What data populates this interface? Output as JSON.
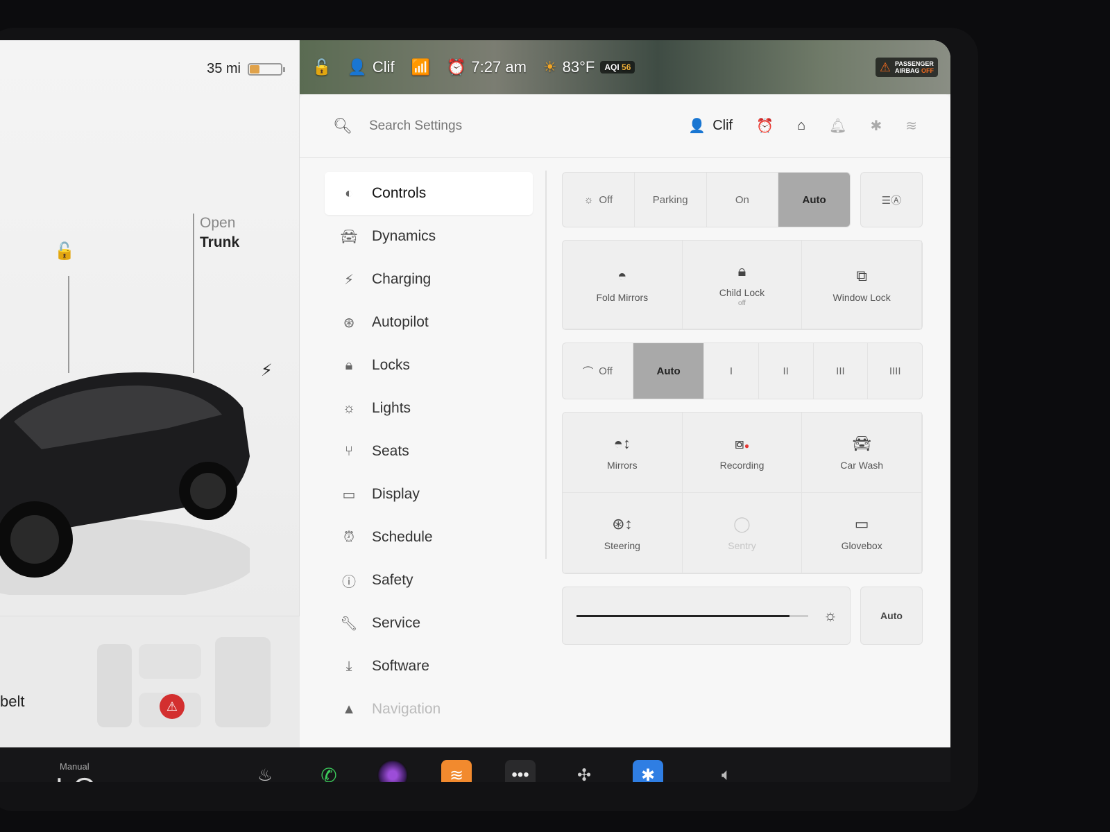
{
  "car_panel": {
    "range": "35 mi",
    "battery_level": 0.3,
    "trunk_label_top": "Open",
    "trunk_label_bottom": "Trunk",
    "seatbelt_text": "belt"
  },
  "status_bar": {
    "profile_name": "Clif",
    "time": "7:27 am",
    "temperature": "83°F",
    "aqi_label": "AQI",
    "aqi_value": "56",
    "airbag_line1": "PASSENGER",
    "airbag_line2": "AIRBAG",
    "airbag_line3": "OFF"
  },
  "settings": {
    "search_placeholder": "Search Settings",
    "profile_name": "Clif"
  },
  "nav": {
    "items": [
      {
        "label": "Controls",
        "icon": "toggle-icon"
      },
      {
        "label": "Dynamics",
        "icon": "car-icon"
      },
      {
        "label": "Charging",
        "icon": "bolt-icon"
      },
      {
        "label": "Autopilot",
        "icon": "steering-wheel-icon"
      },
      {
        "label": "Locks",
        "icon": "lock-icon"
      },
      {
        "label": "Lights",
        "icon": "light-icon"
      },
      {
        "label": "Seats",
        "icon": "seat-icon"
      },
      {
        "label": "Display",
        "icon": "display-icon"
      },
      {
        "label": "Schedule",
        "icon": "alarm-icon"
      },
      {
        "label": "Safety",
        "icon": "info-icon"
      },
      {
        "label": "Service",
        "icon": "wrench-icon"
      },
      {
        "label": "Software",
        "icon": "download-icon"
      },
      {
        "label": "Navigation",
        "icon": "navigation-icon"
      }
    ]
  },
  "controls": {
    "headlights": {
      "off": "Off",
      "parking": "Parking",
      "on": "On",
      "auto": "Auto",
      "selected": "Auto"
    },
    "fold_mirrors": "Fold Mirrors",
    "child_lock": "Child Lock",
    "child_lock_state": "off",
    "window_lock": "Window Lock",
    "wipers": {
      "off": "Off",
      "auto": "Auto",
      "s1": "I",
      "s2": "II",
      "s3": "III",
      "s4": "IIII",
      "selected": "Auto"
    },
    "mirrors": "Mirrors",
    "recording": "Recording",
    "car_wash": "Car Wash",
    "steering": "Steering",
    "sentry": "Sentry",
    "glovebox": "Glovebox",
    "brightness_level": 0.92,
    "brightness_auto": "Auto"
  },
  "dock": {
    "climate_mode": "Manual",
    "temperature": "LO"
  },
  "colors": {
    "accent_orange": "#f07a2a",
    "selected_segment": "#a9a9a9",
    "bluetooth_blue": "#2f7ee3",
    "phone_green": "#3ccb5b",
    "seatbelt_red": "#d32f2f"
  }
}
